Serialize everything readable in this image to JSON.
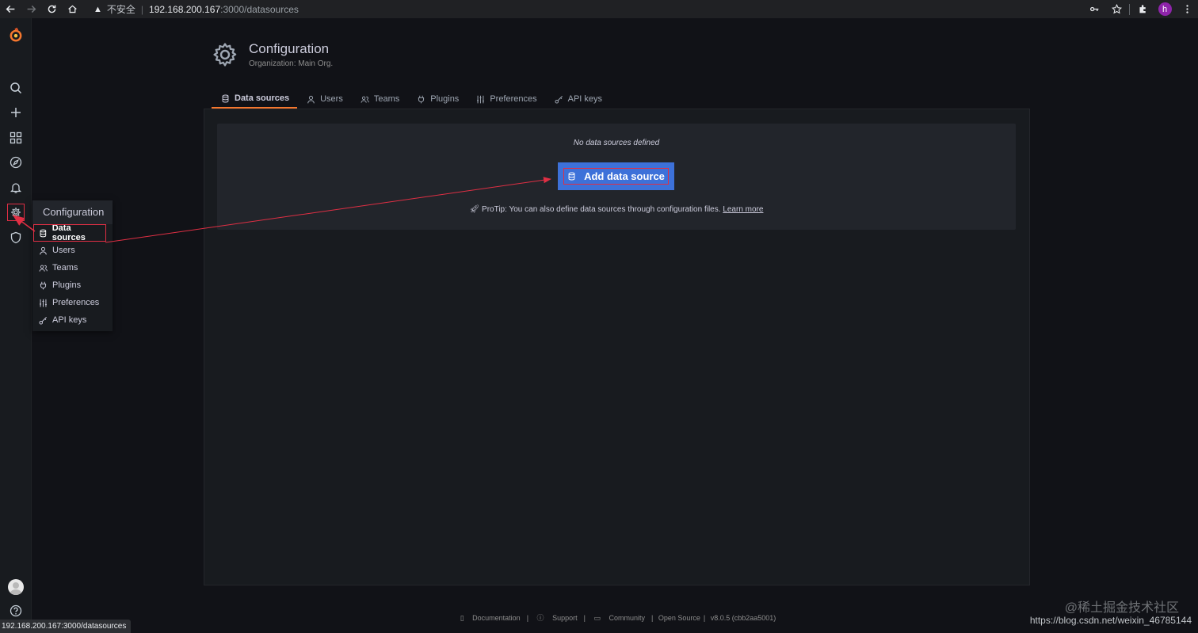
{
  "browser": {
    "security_label": "不安全",
    "url_host": "192.168.200.167",
    "url_path": ":3000/datasources",
    "profile_initial": "h"
  },
  "sidemenu": {
    "items": [
      "grafana-logo-icon",
      "search-icon",
      "plus-icon",
      "dashboards-icon",
      "explore-icon",
      "alerting-icon",
      "gear-icon",
      "shield-icon",
      "avatar",
      "help-icon"
    ]
  },
  "config_menu": {
    "header": "Configuration",
    "items": [
      {
        "label": "Data sources",
        "icon": "database-icon"
      },
      {
        "label": "Users",
        "icon": "user-icon"
      },
      {
        "label": "Teams",
        "icon": "users-icon"
      },
      {
        "label": "Plugins",
        "icon": "plug-icon"
      },
      {
        "label": "Preferences",
        "icon": "sliders-icon"
      },
      {
        "label": "API keys",
        "icon": "key-icon"
      }
    ]
  },
  "page": {
    "title": "Configuration",
    "subtitle": "Organization: Main Org.",
    "tabs": [
      {
        "label": "Data sources",
        "active": true
      },
      {
        "label": "Users"
      },
      {
        "label": "Teams"
      },
      {
        "label": "Plugins"
      },
      {
        "label": "Preferences"
      },
      {
        "label": "API keys"
      }
    ],
    "empty_message": "No data sources defined",
    "add_button": "Add data source",
    "protip": "ProTip: You can also define data sources through configuration files.",
    "protip_link": "Learn more"
  },
  "footer": {
    "documentation": "Documentation",
    "support": "Support",
    "community": "Community",
    "open_source": "Open Source",
    "version": "v8.0.5 (cbb2aa5001)"
  },
  "statusbar": "192.168.200.167:3000/datasources",
  "watermark": {
    "line1": "@稀土掘金技术社区",
    "line2": "https://blog.csdn.net/weixin_46785144"
  },
  "colors": {
    "accent": "#f5772e",
    "primary_button": "#3d71d9",
    "annotation": "#e02f44"
  }
}
